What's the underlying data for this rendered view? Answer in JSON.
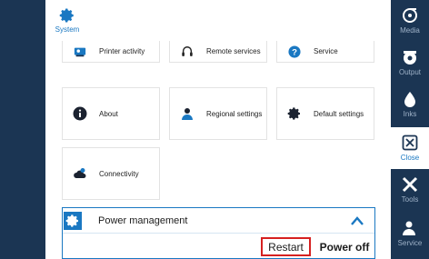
{
  "system_tab": {
    "label": "System",
    "icon": "gear-icon"
  },
  "tiles": [
    {
      "label": "Printer activity",
      "icon": "printer-activity-icon"
    },
    {
      "label": "Remote services",
      "icon": "headset-icon"
    },
    {
      "label": "Service",
      "icon": "question-icon"
    },
    {
      "label": "About",
      "icon": "info-icon"
    },
    {
      "label": "Regional settings",
      "icon": "user-location-icon"
    },
    {
      "label": "Default settings",
      "icon": "gear-icon"
    },
    {
      "label": "Connectivity",
      "icon": "cloud-user-icon"
    }
  ],
  "power_management": {
    "label": "Power management",
    "icon": "power-settings-icon",
    "restart_label": "Restart",
    "power_off_label": "Power off"
  },
  "right_nav": [
    {
      "label": "Media",
      "icon": "media-icon"
    },
    {
      "label": "Output",
      "icon": "output-icon"
    },
    {
      "label": "Inks",
      "icon": "ink-drop-icon"
    },
    {
      "label": "Close",
      "icon": "close-icon",
      "active": true
    },
    {
      "label": "Tools",
      "icon": "tools-icon"
    },
    {
      "label": "Service",
      "icon": "service-user-icon"
    }
  ],
  "colors": {
    "accent": "#1a78c2",
    "nav_bg": "#1b3553",
    "highlight": "#d62020"
  }
}
